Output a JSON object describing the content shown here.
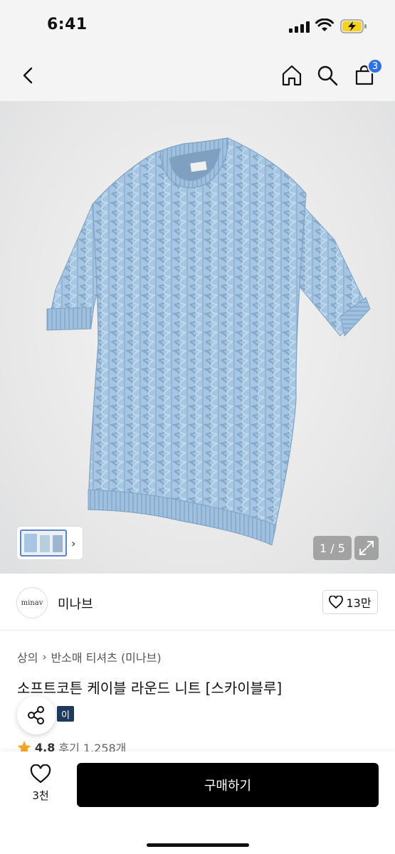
{
  "status": {
    "time": "6:41"
  },
  "nav": {
    "cart_count": "3"
  },
  "gallery": {
    "page_indicator": "1 / 5"
  },
  "brand": {
    "logo_text": "minav",
    "name": "미나브",
    "likes": "13만"
  },
  "product": {
    "breadcrumb": [
      "상의",
      "반소매 티셔츠 (미나브)"
    ],
    "title": "소프트코튼 케이블 라운드 니트 [스카이블루]",
    "tag": "이",
    "rating": "4.8",
    "reviews": "후기 1,258개"
  },
  "bottom": {
    "wish_count": "3천",
    "buy_label": "구매하기"
  },
  "colors": {
    "accent": "#2f6fe8",
    "buy_button": "#000000",
    "tag_bg": "#203a5c",
    "sweater": "#a6c6e3",
    "star": "#f5a623"
  }
}
